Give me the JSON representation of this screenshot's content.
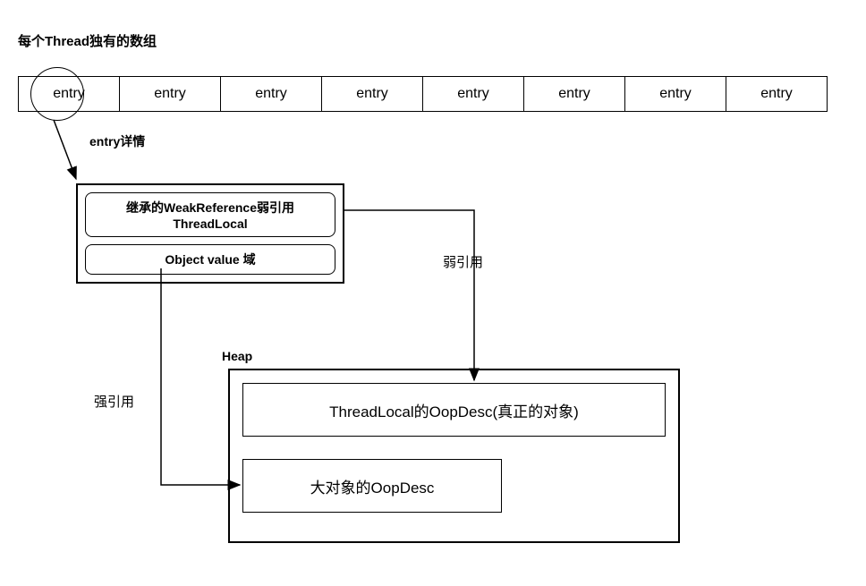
{
  "title": "每个Thread独有的数组",
  "array": [
    "entry",
    "entry",
    "entry",
    "entry",
    "entry",
    "entry",
    "entry",
    "entry"
  ],
  "entry_detail_label": "entry详情",
  "detail": {
    "weak_ref": "继承的WeakReference弱引用\nThreadLocal",
    "weak_ref_line1": "继承的WeakReference弱引用",
    "weak_ref_line2": "ThreadLocal",
    "value_field": "Object value 域"
  },
  "heap_label": "Heap",
  "heap": {
    "threadlocal_oop": "ThreadLocal的OopDesc(真正的对象)",
    "object_oop": "大对象的OopDesc"
  },
  "weak_ref_arrow": "弱引用",
  "strong_ref_arrow": "强引用"
}
